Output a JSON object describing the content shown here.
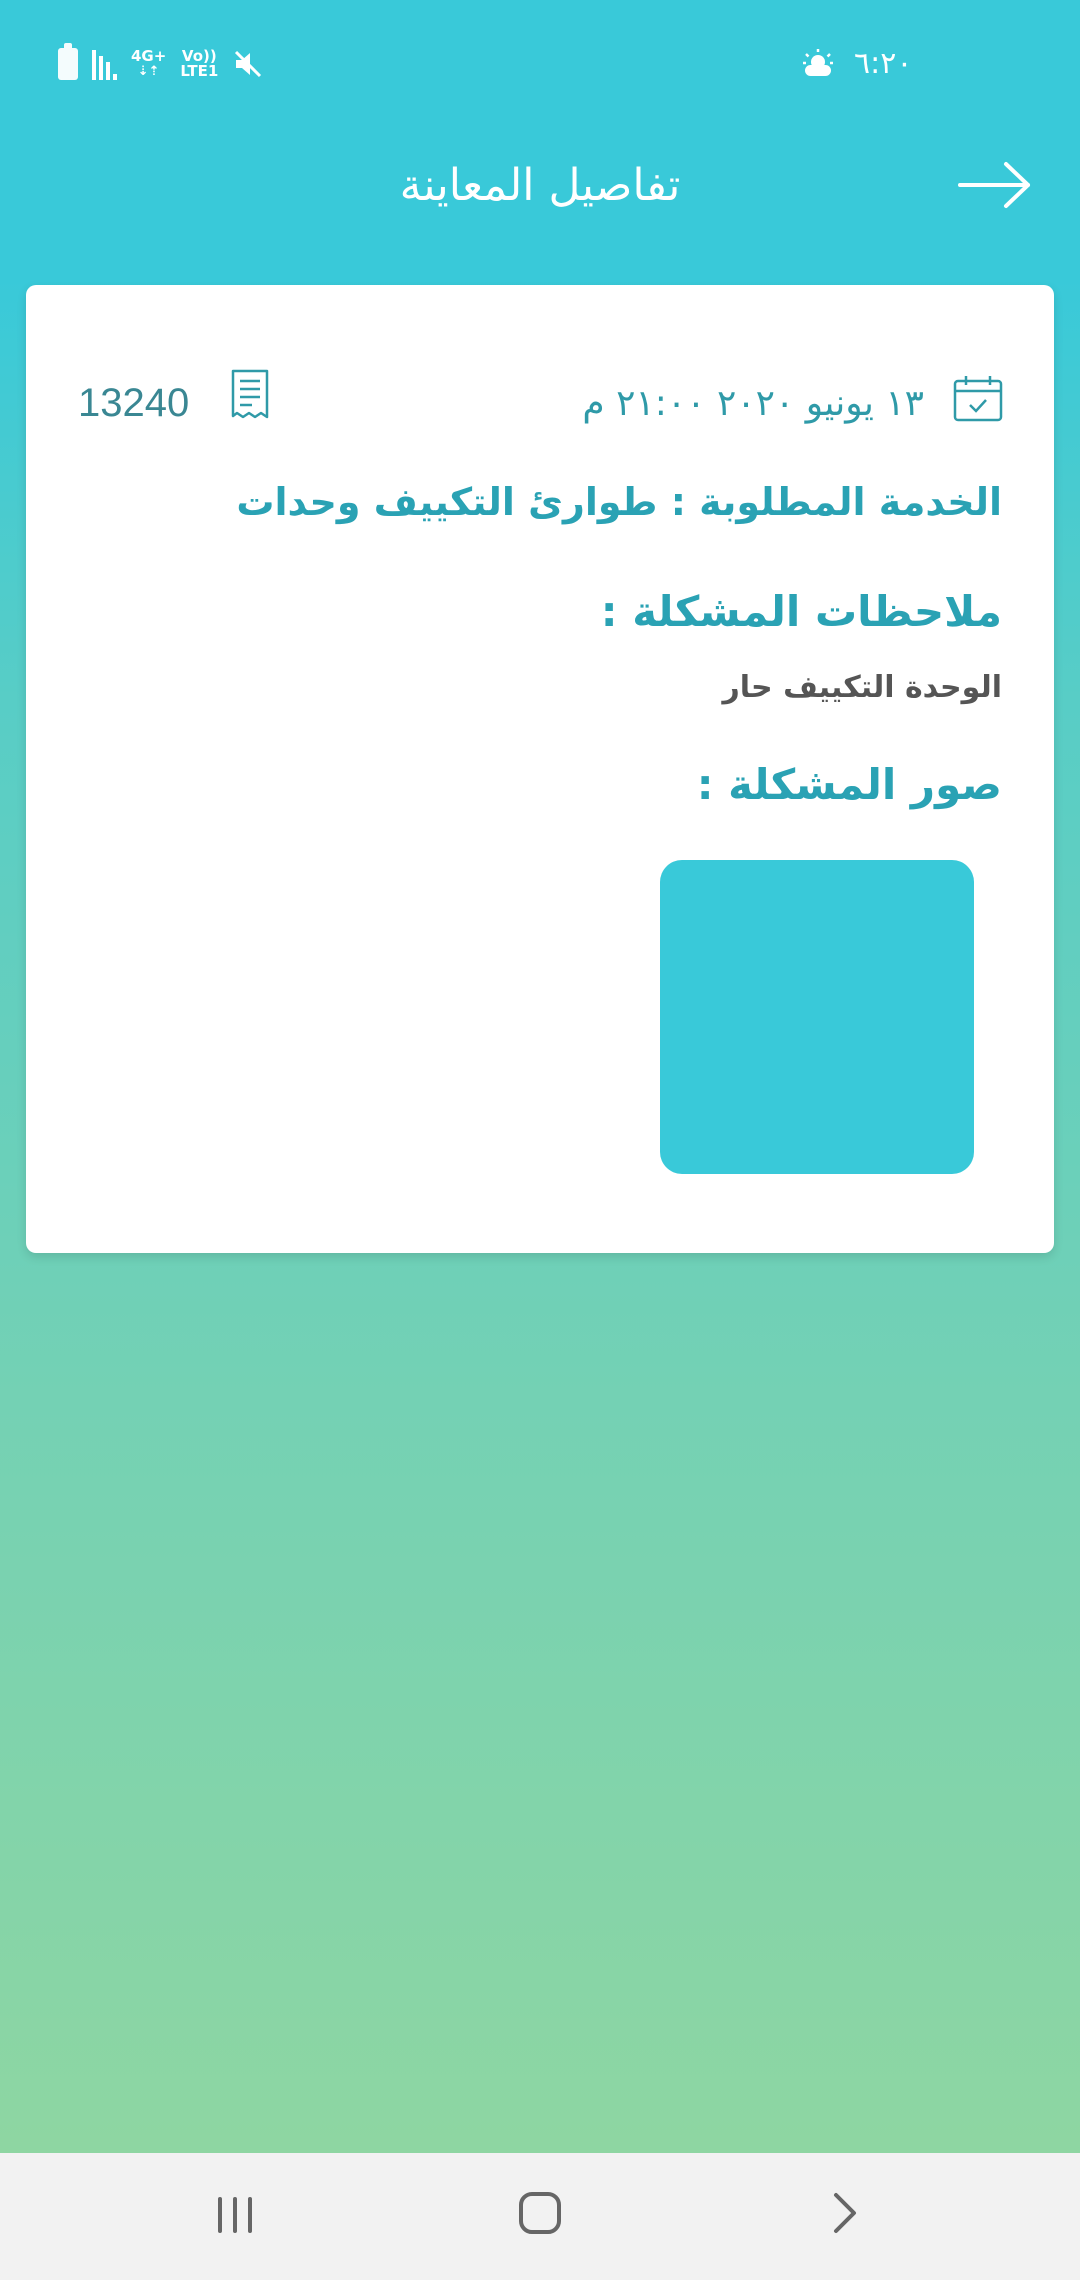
{
  "status_bar": {
    "network_top": "4G+",
    "volte": "Vo))",
    "lte": "LTE1",
    "time": "٦:٢٠"
  },
  "header": {
    "title": "تفاصيل المعاينة"
  },
  "card": {
    "date_time": "١٣ يونيو ٢٠٢٠ ٢١:٠٠ م",
    "order_number": "13240",
    "service_line": "الخدمة المطلوبة : طوارئ التكييف وحدات",
    "notes_heading": "ملاحظات المشكلة :",
    "notes_text": "الوحدة التكييف حار",
    "photos_heading": "صور المشكلة :"
  },
  "colors": {
    "accent": "#39c9d9",
    "text_accent": "#2aa2b4",
    "gradient_bottom": "#8ed6a2"
  },
  "icons": [
    "battery-icon",
    "signal-icon",
    "mute-icon",
    "weather-icon",
    "back-arrow-icon",
    "calendar-icon",
    "receipt-icon",
    "recent-apps-icon",
    "home-icon",
    "back-icon"
  ]
}
